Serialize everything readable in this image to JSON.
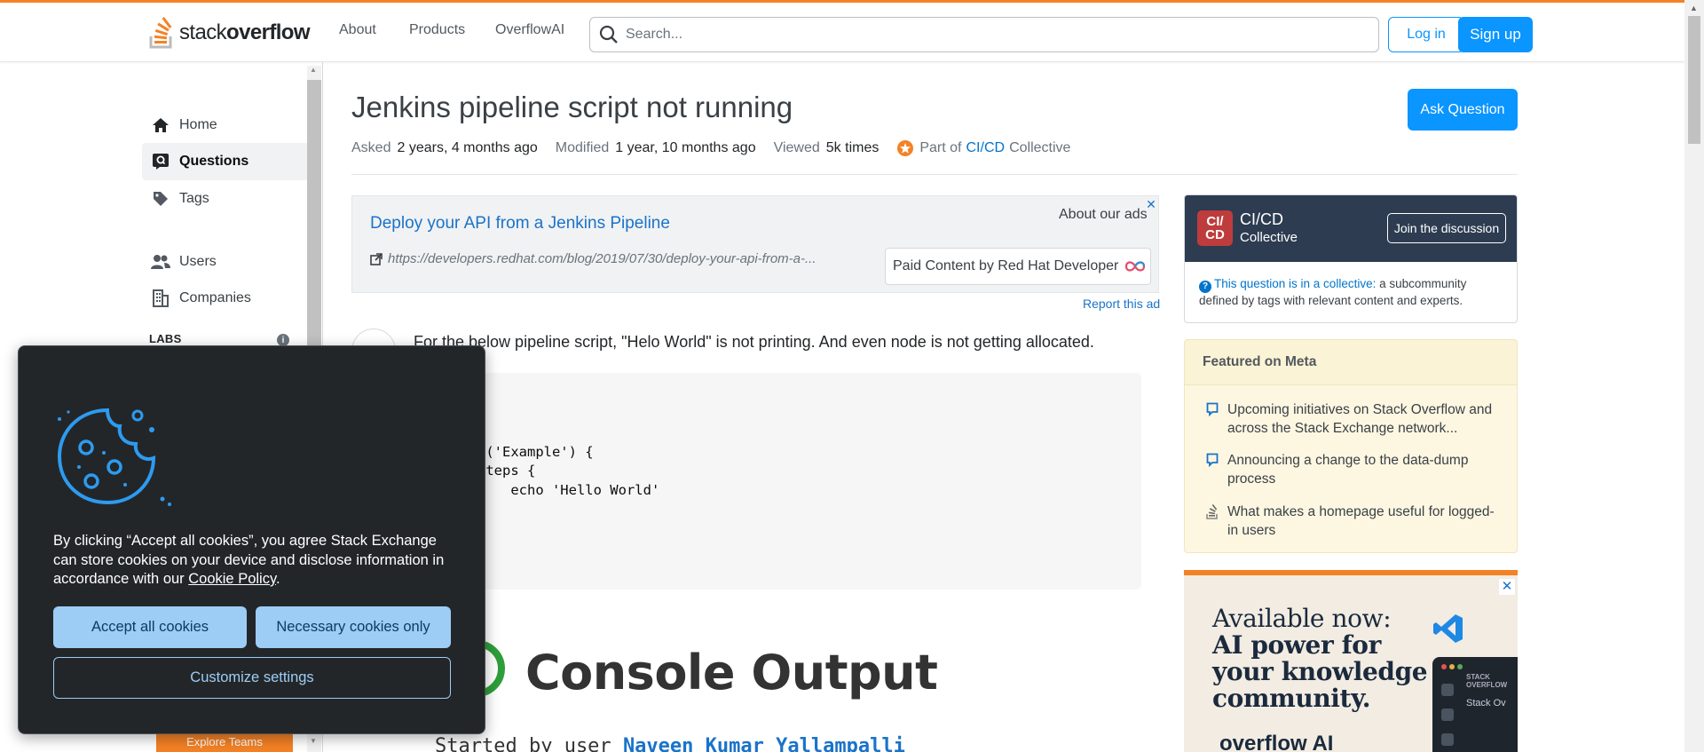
{
  "header": {
    "logo_text_light": "stack",
    "logo_text_bold": "overflow",
    "nav": [
      "About",
      "Products",
      "OverflowAI"
    ],
    "search_placeholder": "Search...",
    "login_label": "Log in",
    "signup_label": "Sign up",
    "accent_color": "#f48225"
  },
  "sidebar": {
    "items": [
      {
        "label": "Home",
        "icon": "home-icon"
      },
      {
        "label": "Questions",
        "icon": "questions-icon",
        "active": true
      },
      {
        "label": "Tags",
        "icon": "tag-icon"
      },
      {
        "label": "Users",
        "icon": "users-icon"
      },
      {
        "label": "Companies",
        "icon": "companies-icon"
      }
    ],
    "labs_label": "LABS",
    "explore_teams_label": "Explore Teams"
  },
  "question": {
    "title": "Jenkins pipeline script not running",
    "ask_label": "Ask Question",
    "asked_key": "Asked",
    "asked_value": "2 years, 4 months ago",
    "modified_key": "Modified",
    "modified_value": "1 year, 10 months ago",
    "viewed_key": "Viewed",
    "viewed_value": "5k times",
    "collective_prefix": "Part of",
    "collective_link": "CI/CD",
    "collective_suffix": "Collective",
    "body_text": "For the below pipeline script, \"Helo World\" is not printing. And even node is not getting allocated.",
    "code": "ne {\nnt any\nges {\n  stage('Example') {\n      steps {\n          echo 'Hello World'\n      }\n  }",
    "console_title": "Console Output",
    "started_prefix": "Started by user",
    "started_user": "Naveen Kumar Yallampalli"
  },
  "ad": {
    "title": "Deploy your API from a Jenkins Pipeline",
    "url": "https://developers.redhat.com/blog/2019/07/30/deploy-your-api-from-a-...",
    "about": "About our ads",
    "badge": "Paid Content by Red Hat Developer",
    "report": "Report this ad"
  },
  "collective": {
    "logo_line1": "CI/",
    "logo_line2": "CD",
    "name": "CI/CD",
    "sub": "Collective",
    "join_label": "Join the discussion",
    "note_link": "This question is in a collective:",
    "note_rest": "a subcommunity defined by tags with relevant content and experts."
  },
  "featured_meta": {
    "title": "Featured on Meta",
    "items": [
      {
        "text": "Upcoming initiatives on Stack Overflow and across the Stack Exchange network...",
        "icon": "speech-bubble-icon"
      },
      {
        "text": "Announcing a change to the data-dump process",
        "icon": "speech-bubble-icon"
      },
      {
        "text": "What makes a homepage useful for logged-in users",
        "icon": "stack-exchange-icon"
      }
    ]
  },
  "ad2": {
    "line1": "Available now:",
    "line2": "AI power for",
    "line3": "your knowledge",
    "line4": "community.",
    "mock_title": "STACK OVERFLOW",
    "mock_sub": "Stack Ov",
    "brand": "overflow AI"
  },
  "cookie": {
    "text_before": "By clicking “Accept all cookies”, you agree Stack Exchange can store cookies on your device and disclose information in accordance with our ",
    "policy_link": "Cookie Policy",
    "text_after": ".",
    "accept_label": "Accept all cookies",
    "necessary_label": "Necessary cookies only",
    "customize_label": "Customize settings"
  }
}
